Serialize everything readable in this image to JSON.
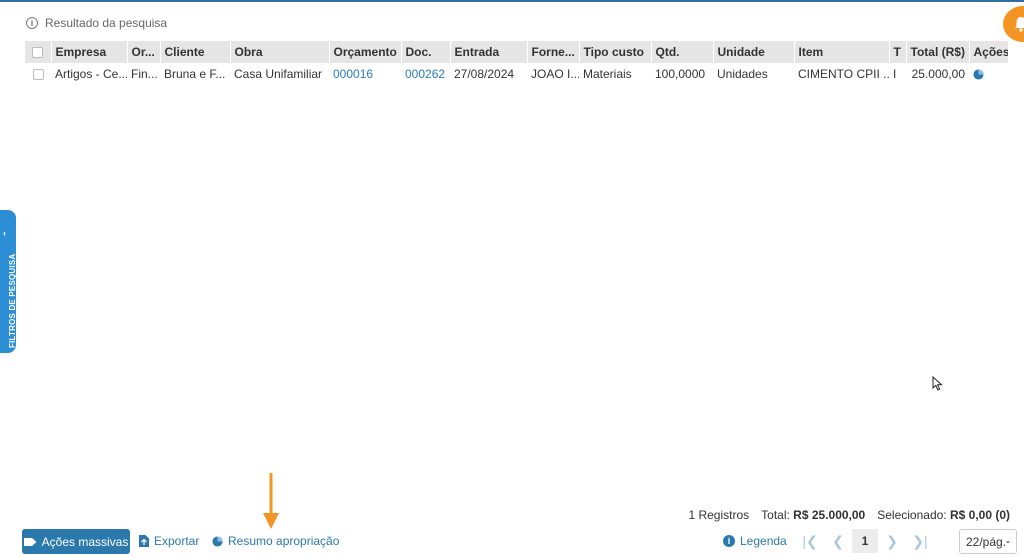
{
  "page": {
    "result_title": "Resultado da pesquisa",
    "side_filter_label": "FILTROS DE PESQUISA"
  },
  "table": {
    "columns": [
      "Empresa",
      "Or...",
      "Cliente",
      "Obra",
      "Orçamento",
      "Doc.",
      "Entrada",
      "Forne...",
      "Tipo custo",
      "Qtd.",
      "Unidade",
      "Item",
      "T",
      "Total (R$)",
      "Ações"
    ],
    "rows": [
      {
        "empresa": "Artigos - Ce...",
        "or": "Fin...",
        "cliente": "Bruna e F...",
        "obra": "Casa Unifamiliar",
        "orcamento": "000016",
        "doc": "000262",
        "entrada": "27/08/2024",
        "fornecedor": "JOAO I...",
        "tipo_custo": "Materiais",
        "qtd": "100,0000",
        "unidade": "Unidades",
        "item": "CIMENTO CPII ...",
        "t": "I",
        "total": "25.000,00"
      }
    ]
  },
  "summary": {
    "registros": "1 Registros",
    "total_label": "Total:",
    "total_value": "R$ 25.000,00",
    "selecionado_label": "Selecionado:",
    "selecionado_value": "R$ 0,00 (0)"
  },
  "footer": {
    "acoes_massivas": "Ações massivas",
    "exportar": "Exportar",
    "resumo_apropriacao": "Resumo apropriação",
    "legenda": "Legenda",
    "current_page": "1",
    "per_page": "22/pág."
  },
  "colors": {
    "accent": "#2b78ad",
    "side_tab": "#2c8fd6",
    "notification": "#f39425",
    "annotation_arrow": "#f39425"
  },
  "icons": {
    "info": "info-icon",
    "pie": "pie-chart-icon",
    "bell": "bell-icon",
    "export": "export-icon",
    "tag": "tag-icon"
  }
}
